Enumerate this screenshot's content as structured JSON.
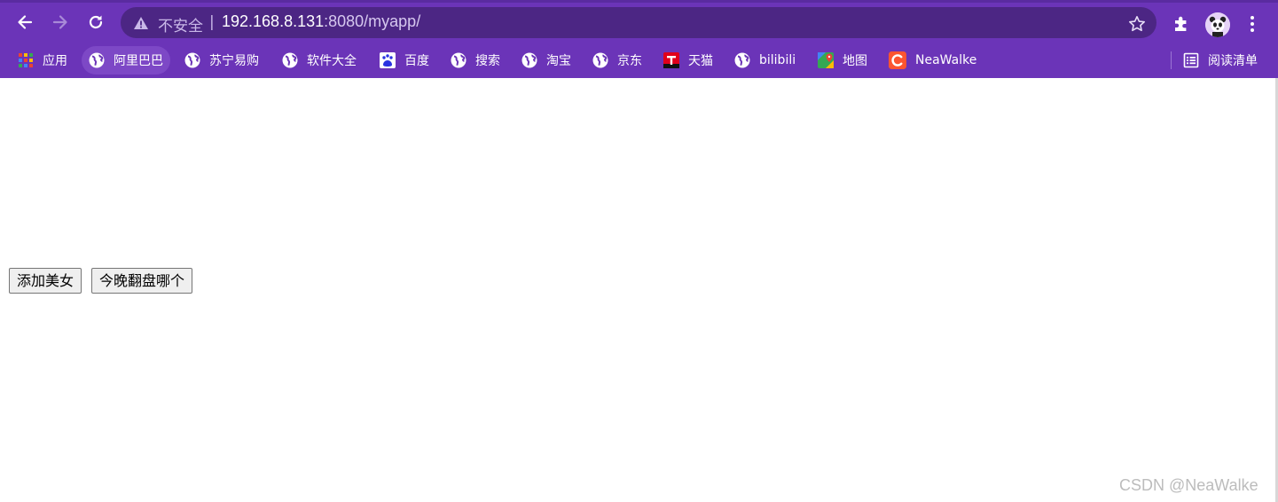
{
  "colors": {
    "chrome": "#6b34b8",
    "omnibox": "#4c2684",
    "accent": "#ffffff"
  },
  "address_bar": {
    "security_label": "不安全",
    "separator": "|",
    "url_host": "192.168.8.131",
    "url_rest": ":8080/myapp/"
  },
  "bookmarks": {
    "items": [
      {
        "label": "应用",
        "icon": "apps-grid-icon"
      },
      {
        "label": "阿里巴巴",
        "icon": "globe-icon"
      },
      {
        "label": "苏宁易购",
        "icon": "globe-icon"
      },
      {
        "label": "软件大全",
        "icon": "globe-icon"
      },
      {
        "label": "百度",
        "icon": "baidu-paw-icon"
      },
      {
        "label": "搜索",
        "icon": "globe-icon"
      },
      {
        "label": "淘宝",
        "icon": "globe-icon"
      },
      {
        "label": "京东",
        "icon": "globe-icon"
      },
      {
        "label": "天猫",
        "icon": "tmall-icon"
      },
      {
        "label": "bilibili",
        "icon": "globe-icon"
      },
      {
        "label": "地图",
        "icon": "maps-icon"
      },
      {
        "label": "NeaWalke",
        "icon": "csdn-c-icon"
      }
    ],
    "reading_list": "阅读清单"
  },
  "content": {
    "add_button": "添加美女",
    "flip_button": "今晚翻盘哪个"
  },
  "watermark": "CSDN @NeaWalke"
}
